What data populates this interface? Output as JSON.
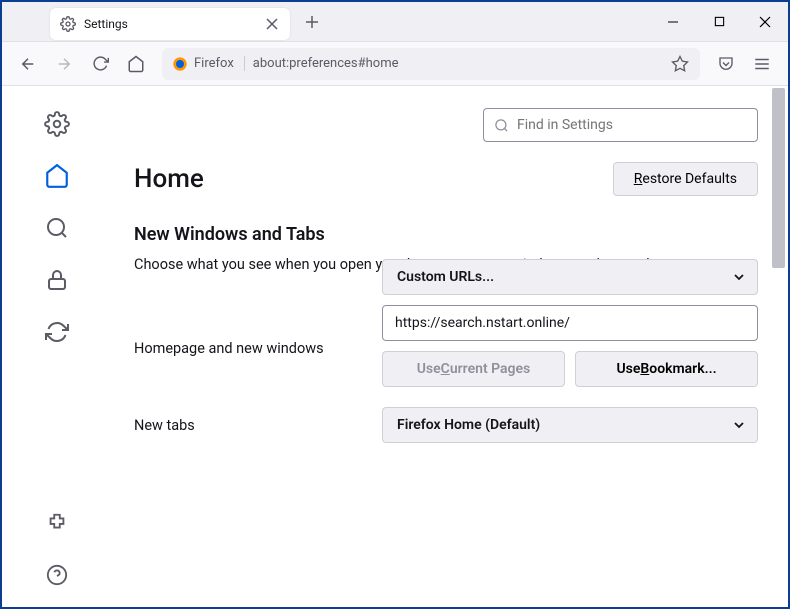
{
  "tab": {
    "title": "Settings"
  },
  "urlbar": {
    "identity": "Firefox",
    "url": "about:preferences#home"
  },
  "search": {
    "placeholder": "Find in Settings"
  },
  "heading": "Home",
  "restore": "estore Defaults",
  "restore_u": "R",
  "section": {
    "title": "New Windows and Tabs",
    "desc": "Choose what you see when you open your homepage, new windows, and new tabs."
  },
  "homepage": {
    "label": "Homepage and new windows",
    "select": "Custom URLs...",
    "value": "https://search.nstart.online/",
    "btn1_pre": "Use ",
    "btn1_u": "C",
    "btn1_post": "urrent Pages",
    "btn2_pre": "Use ",
    "btn2_u": "B",
    "btn2_post": "ookmark..."
  },
  "newtabs": {
    "label": "New tabs",
    "select": "Firefox Home (Default)"
  }
}
